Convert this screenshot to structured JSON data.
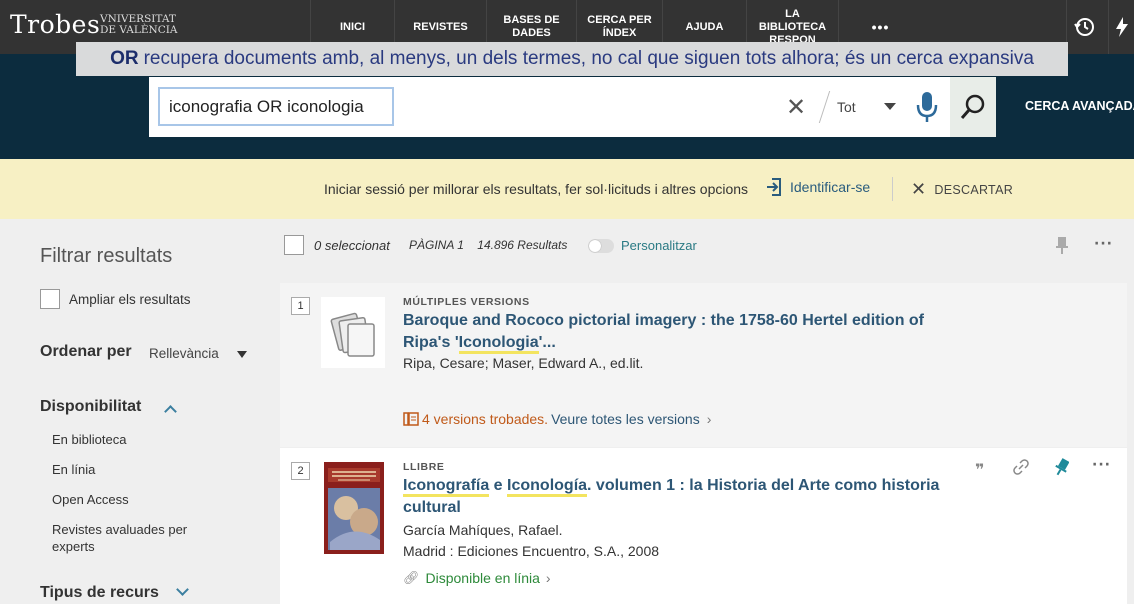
{
  "brand": {
    "logo": "Trobes",
    "university": [
      "VNIVERSITAT",
      "DE VALÈNCIA"
    ]
  },
  "nav": {
    "items": [
      "INICI",
      "REVISTES",
      "BASES DE DADES",
      "CERCA PER ÍNDEX",
      "AJUDA",
      "LA BIBLIOTECA RESPON"
    ],
    "more": "•••"
  },
  "search": {
    "tooltip_keyword": "OR",
    "tooltip_text": "recupera documents amb, al menys, un dels termes, no cal que siguen tots alhora; és un cerca expansiva",
    "query": "iconografia OR iconologia",
    "scope": "Tot",
    "advanced": "CERCA AVANÇADA"
  },
  "banner": {
    "message": "Iniciar sessió per millorar els resultats, fer sol·licituds i altres opcions",
    "signin": "Identificar-se",
    "dismiss": "DESCARTAR"
  },
  "facets": {
    "title": "Filtrar resultats",
    "expand": "Ampliar els resultats",
    "sort_label": "Ordenar per",
    "sort_value": "Rellevància",
    "availability_title": "Disponibilitat",
    "availability_items": [
      "En biblioteca",
      "En línia",
      "Open Access",
      "Revistes avaluades per experts"
    ],
    "resource_type_title": "Tipus de recurs"
  },
  "results_header": {
    "selected": "0 seleccionat",
    "page": "PÀGINA 1",
    "count": "14.896 Resultats",
    "personalize": "Personalitzar"
  },
  "results": [
    {
      "number": "1",
      "type": "MÚLTIPLES VERSIONS",
      "title_a": "Baroque and Rococo pictorial imagery : the 1758-60 Hertel edition of Ripa's '",
      "title_hl": "Iconologia",
      "title_b": "'...",
      "author": "Ripa, Cesare; Maser, Edward A., ed.lit.",
      "versions_count": "4 versions trobades.",
      "versions_link": "Veure totes les versions"
    },
    {
      "number": "2",
      "type": "LLIBRE",
      "title_hl1": "Iconografía",
      "title_mid": " e ",
      "title_hl2": "Iconología",
      "title_rest": ". volumen 1 : la Historia del Arte como historia cultural",
      "author": "García Mahíques, Rafael.",
      "publisher": "Madrid : Ediciones Encuentro, S.A., 2008",
      "availability": "Disponible en línia"
    }
  ],
  "colors": {
    "nav_bg": "#333333",
    "search_band": "#0c2c3e",
    "banner": "#f7f0c4",
    "link": "#2d5675",
    "highlight": "#f3e45f",
    "available": "#2d8a3a"
  }
}
